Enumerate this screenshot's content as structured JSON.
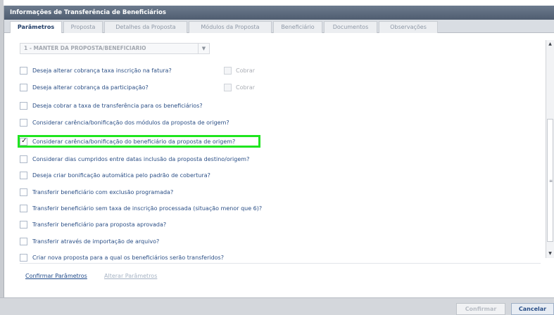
{
  "window": {
    "title": "Informações de Transferência de Beneficiários"
  },
  "tabs": [
    {
      "label": "Parâmetros",
      "active": true
    },
    {
      "label": "Proposta",
      "active": false
    },
    {
      "label": "Detalhes da Proposta",
      "active": false
    },
    {
      "label": "Módulos da Proposta",
      "active": false
    },
    {
      "label": "Beneficiário",
      "active": false
    },
    {
      "label": "Documentos",
      "active": false
    },
    {
      "label": "Observações",
      "active": false
    }
  ],
  "select": {
    "value": "1 - MANTER DA PROPOSTA/BENEFICIARIO",
    "icon": "chevron-down-icon"
  },
  "options": [
    {
      "label": "Deseja alterar cobrança taxa inscrição na fatura?",
      "checked": false,
      "cobrar_label": "Cobrar"
    },
    {
      "label": "Deseja alterar cobrança da participação?",
      "checked": false,
      "cobrar_label": "Cobrar"
    },
    {
      "label": "Deseja cobrar a taxa de transferência para os beneficiários?",
      "checked": false
    },
    {
      "label": "Considerar carência/bonificação dos módulos da proposta de origem?",
      "checked": false
    },
    {
      "label": "Considerar carência/bonificação do beneficiário da proposta de origem?",
      "checked": true
    },
    {
      "label": "Considerar dias cumpridos entre datas inclusão da proposta destino/origem?",
      "checked": false
    },
    {
      "label": "Deseja criar bonificação automática pelo padrão de cobertura?",
      "checked": false
    },
    {
      "label": "Transferir beneficiário com exclusão programada?",
      "checked": false
    },
    {
      "label": "Transferir beneficiário sem taxa de inscrição processada (situação menor que 6)?",
      "checked": false
    },
    {
      "label": "Transferir beneficiário para proposta aprovada?",
      "checked": false
    },
    {
      "label": "Transferir através de importação de arquivo?",
      "checked": false
    },
    {
      "label": "Criar nova proposta para a qual os beneficiários serão transferidos?",
      "checked": false
    }
  ],
  "links": {
    "confirm": "Confirmar Parâmetros",
    "alter": "Alterar Parâmetros"
  },
  "buttons": {
    "confirm": "Confirmar",
    "cancel": "Cancelar"
  },
  "colors": {
    "highlight": "#1fe51f",
    "link": "#1f4a8a",
    "titlebar": "#5a6879"
  }
}
